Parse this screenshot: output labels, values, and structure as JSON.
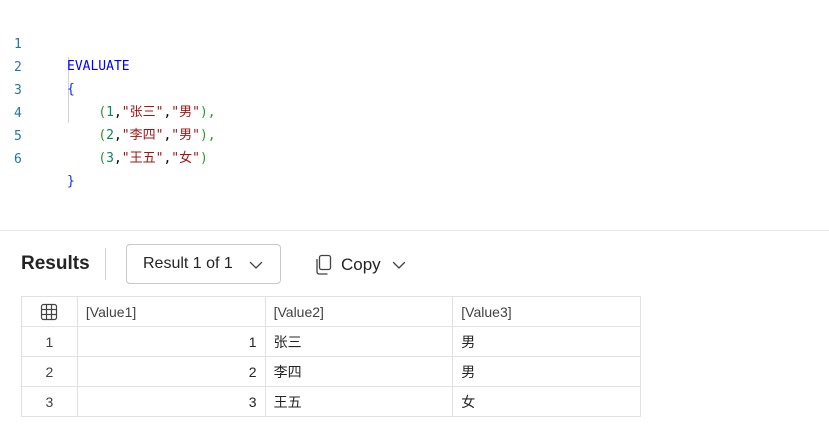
{
  "editor": {
    "line_numbers": [
      "1",
      "2",
      "3",
      "4",
      "5",
      "6"
    ],
    "keyword": "EVALUATE",
    "open_brace": "{",
    "close_brace": "}",
    "rows": [
      {
        "num": "1",
        "v2": "\"张三\"",
        "v3": "\"男\"",
        "trail": "),"
      },
      {
        "num": "2",
        "v2": "\"李四\"",
        "v3": "\"男\"",
        "trail": "),"
      },
      {
        "num": "3",
        "v2": "\"王五\"",
        "v3": "\"女\"",
        "trail": ")"
      }
    ]
  },
  "results_bar": {
    "title": "Results",
    "result_selector": "Result 1 of 1",
    "copy_label": "Copy"
  },
  "grid": {
    "columns": [
      "[Value1]",
      "[Value2]",
      "[Value3]"
    ],
    "rows": [
      {
        "index": "1",
        "cells": [
          "1",
          "张三",
          "男"
        ]
      },
      {
        "index": "2",
        "cells": [
          "2",
          "李四",
          "男"
        ]
      },
      {
        "index": "3",
        "cells": [
          "3",
          "王五",
          "女"
        ]
      }
    ]
  },
  "icons": {
    "table_icon": "table-grid-icon",
    "copy_icon": "copy-icon",
    "chevron": "chevron-down-icon"
  },
  "colors": {
    "keyword": "#0000ff",
    "string": "#a31515",
    "number": "#098658",
    "paren": "#319331",
    "line_number": "#237893"
  }
}
